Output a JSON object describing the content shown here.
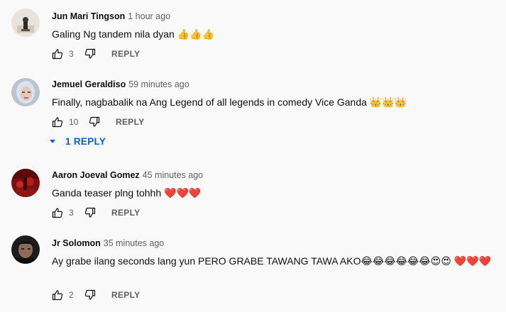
{
  "comments": [
    {
      "author": "Jun Mari Tingson",
      "time": "1 hour ago",
      "text": "Galing Ng tandem nila dyan 👍👍👍",
      "likes": "3",
      "reply_label": "REPLY"
    },
    {
      "author": "Jemuel Geraldiso",
      "time": "59 minutes ago",
      "text": "Finally, nagbabalik na Ang Legend of all legends in comedy Vice Ganda 👑👑👑",
      "likes": "10",
      "reply_label": "REPLY",
      "replies_label": "1 REPLY"
    },
    {
      "author": "Aaron Joeval Gomez",
      "time": "45 minutes ago",
      "text": "Ganda teaser plng tohhh ❤️❤️❤️",
      "likes": "3",
      "reply_label": "REPLY"
    },
    {
      "author": "Jr Solomon",
      "time": "35 minutes ago",
      "text": "Ay grabe ilang seconds lang yun  PERO GRABE TAWANG TAWA AKO😂😂😂😂😂😂😍😍 ❤️❤️❤️",
      "likes": "2",
      "reply_label": "REPLY"
    }
  ],
  "colors": {
    "background": "#f9f9f9",
    "link_blue": "#065fd4",
    "secondary_text": "#606060"
  }
}
